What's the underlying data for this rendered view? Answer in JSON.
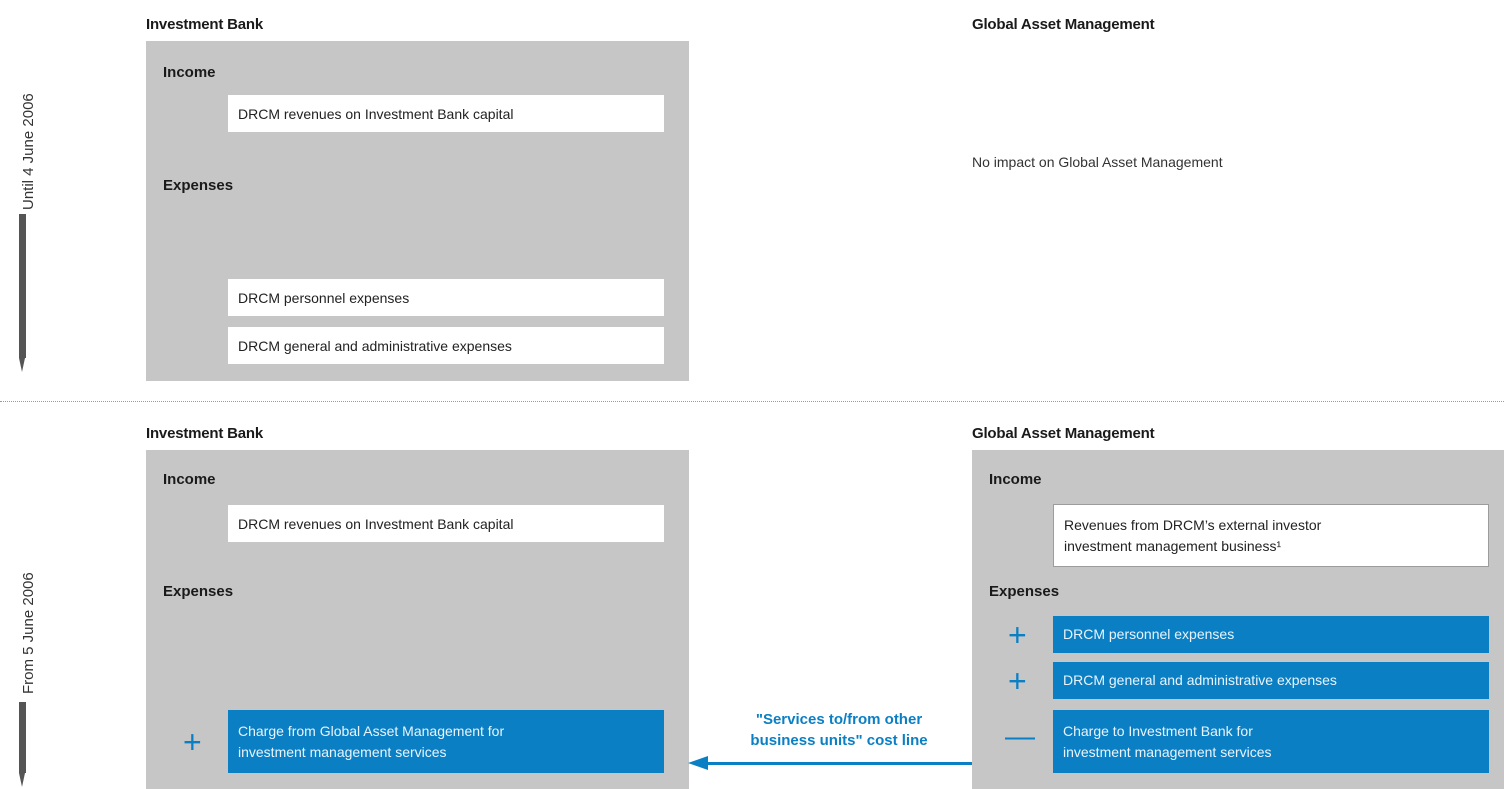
{
  "periods": {
    "top": "Until 4 June 2006",
    "bottom": "From 5 June 2006"
  },
  "top": {
    "ib": {
      "title": "Investment Bank",
      "income_label": "Income",
      "income_item": "DRCM revenues on Investment Bank capital",
      "expenses_label": "Expenses",
      "expense_items": [
        "DRCM personnel expenses",
        "DRCM general and administrative expenses"
      ]
    },
    "gam": {
      "title": "Global Asset Management",
      "note": "No impact on Global Asset Management"
    }
  },
  "bottom": {
    "ib": {
      "title": "Investment Bank",
      "income_label": "Income",
      "income_item": "DRCM revenues on Investment Bank capital",
      "expenses_label": "Expenses",
      "charge_sign": "+",
      "charge_lines": [
        "Charge from Global Asset Management for",
        "investment management services"
      ]
    },
    "gam": {
      "title": "Global Asset Management",
      "income_label": "Income",
      "income_lines": [
        "Revenues from DRCM’s external investor",
        "investment management business¹"
      ],
      "expenses_label": "Expenses",
      "expense_items": [
        {
          "sign": "+",
          "lines": [
            "DRCM personnel expenses"
          ]
        },
        {
          "sign": "+",
          "lines": [
            "DRCM general and administrative expenses"
          ]
        },
        {
          "sign": "—",
          "lines": [
            "Charge to Investment Bank for",
            "investment management services"
          ]
        }
      ]
    }
  },
  "arrow": {
    "label_lines": [
      "\"Services to/from other",
      "business units\" cost line"
    ]
  },
  "colors": {
    "accent_blue": "#0b7fc4",
    "panel_gray": "#c6c6c7",
    "timeline_gray": "#555555"
  }
}
